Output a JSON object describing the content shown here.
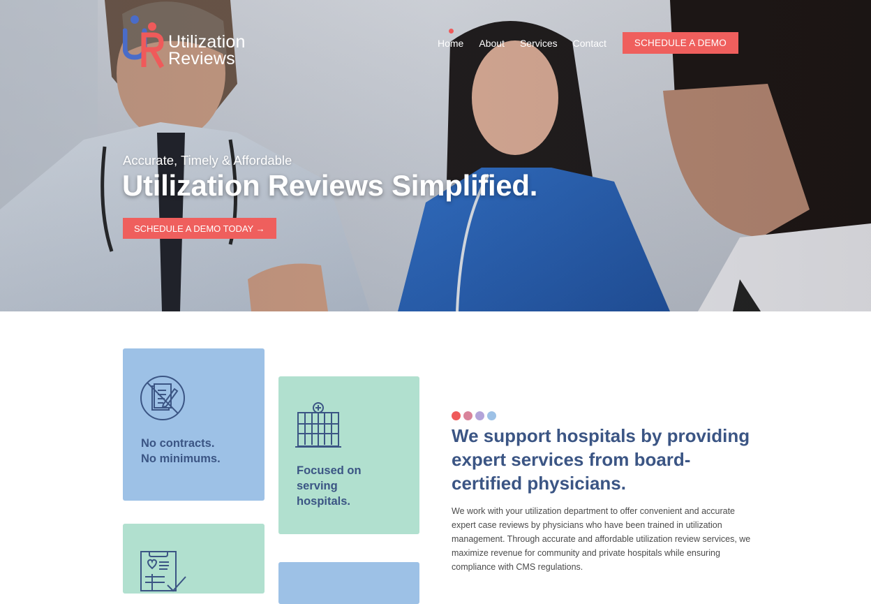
{
  "brand": {
    "line1": "Utilization",
    "line2": "Reviews",
    "colors": {
      "blue": "#4a6cc8",
      "red": "#ef5a5a"
    }
  },
  "nav": {
    "items": [
      {
        "label": "Home",
        "active": true
      },
      {
        "label": "About",
        "active": false
      },
      {
        "label": "Services",
        "active": false
      },
      {
        "label": "Contact",
        "active": false
      }
    ],
    "cta_label": "SCHEDULE A DEMO"
  },
  "hero": {
    "subtitle": "Accurate, Timely & Affordable",
    "title": "Utilization Reviews Simplified.",
    "cta_label": "SCHEDULE A DEMO TODAY →"
  },
  "features": [
    {
      "label_line1": "No contracts.",
      "label_line2": "No minimums.",
      "icon": "no-contract-icon",
      "color": "#9dc1e6"
    },
    {
      "label_line1": "Focused on",
      "label_line2": "serving",
      "label_line3": "hospitals.",
      "icon": "hospital-icon",
      "color": "#b1e0cf"
    },
    {
      "icon": "clipboard-heart-icon",
      "color": "#b1e0cf"
    },
    {
      "color": "#9dc1e6"
    }
  ],
  "about": {
    "dot_colors": [
      "#ef5a5a",
      "#d9839a",
      "#b3a4d9",
      "#9dc1e6"
    ],
    "heading": "We support hospitals by providing expert services from board-certified physicians.",
    "paragraph": "We work with your utilization department to offer convenient and accurate expert case reviews by physicians who have been trained in utilization management. Through accurate and affordable utilization review services, we maximize revenue for community and private hospitals while ensuring compliance with CMS regulations."
  },
  "theme": {
    "accent": "#ef5f5d",
    "heading_color": "#3b5584"
  }
}
